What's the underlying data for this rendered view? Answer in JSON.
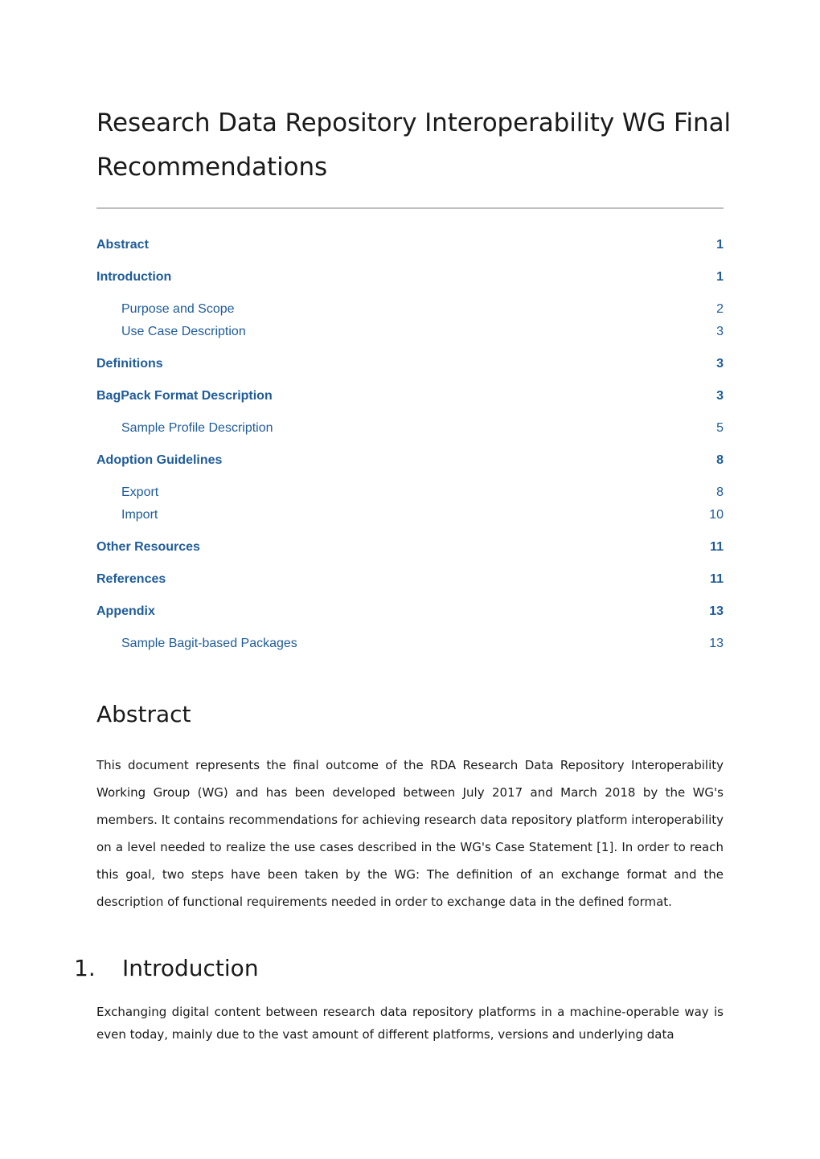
{
  "document": {
    "title": "Research Data Repository Interoperability WG Final Recommendations"
  },
  "toc": {
    "entries": [
      {
        "label": "Abstract",
        "page": "1",
        "level": 1
      },
      {
        "label": "Introduction",
        "page": "1",
        "level": 1
      },
      {
        "label": "Purpose and Scope",
        "page": "2",
        "level": 2
      },
      {
        "label": "Use Case Description",
        "page": "3",
        "level": 2
      },
      {
        "label": "Definitions",
        "page": "3",
        "level": 1
      },
      {
        "label": "BagPack Format Description",
        "page": "3",
        "level": 1
      },
      {
        "label": "Sample Profile Description",
        "page": "5",
        "level": 2
      },
      {
        "label": "Adoption Guidelines",
        "page": "8",
        "level": 1
      },
      {
        "label": "Export",
        "page": "8",
        "level": 2
      },
      {
        "label": "Import",
        "page": "10",
        "level": 2
      },
      {
        "label": "Other Resources",
        "page": "11",
        "level": 1
      },
      {
        "label": "References",
        "page": "11",
        "level": 1
      },
      {
        "label": "Appendix",
        "page": "13",
        "level": 1
      },
      {
        "label": "Sample Bagit-based Packages",
        "page": "13",
        "level": 2
      }
    ],
    "link_color": "#1F5C99"
  },
  "sections": {
    "abstract": {
      "heading": "Abstract",
      "text": "This document represents the final outcome of the RDA Research Data Repository Interoperability Working Group (WG) and has been developed between July 2017 and March 2018 by the WG's members. It contains recommendations for achieving research data repository platform interoperability on a level needed to realize the use cases described in the WG's Case Statement [1]. In order to reach this goal, two steps have been taken by the WG: The definition of an exchange format and the description of functional requirements needed in order to exchange data in the defined format."
    },
    "introduction": {
      "number": "1.",
      "heading": "Introduction",
      "text": "Exchanging digital content between research data repository platforms in a machine-operable way is even today, mainly due to the vast amount of different platforms, versions and underlying data"
    }
  }
}
